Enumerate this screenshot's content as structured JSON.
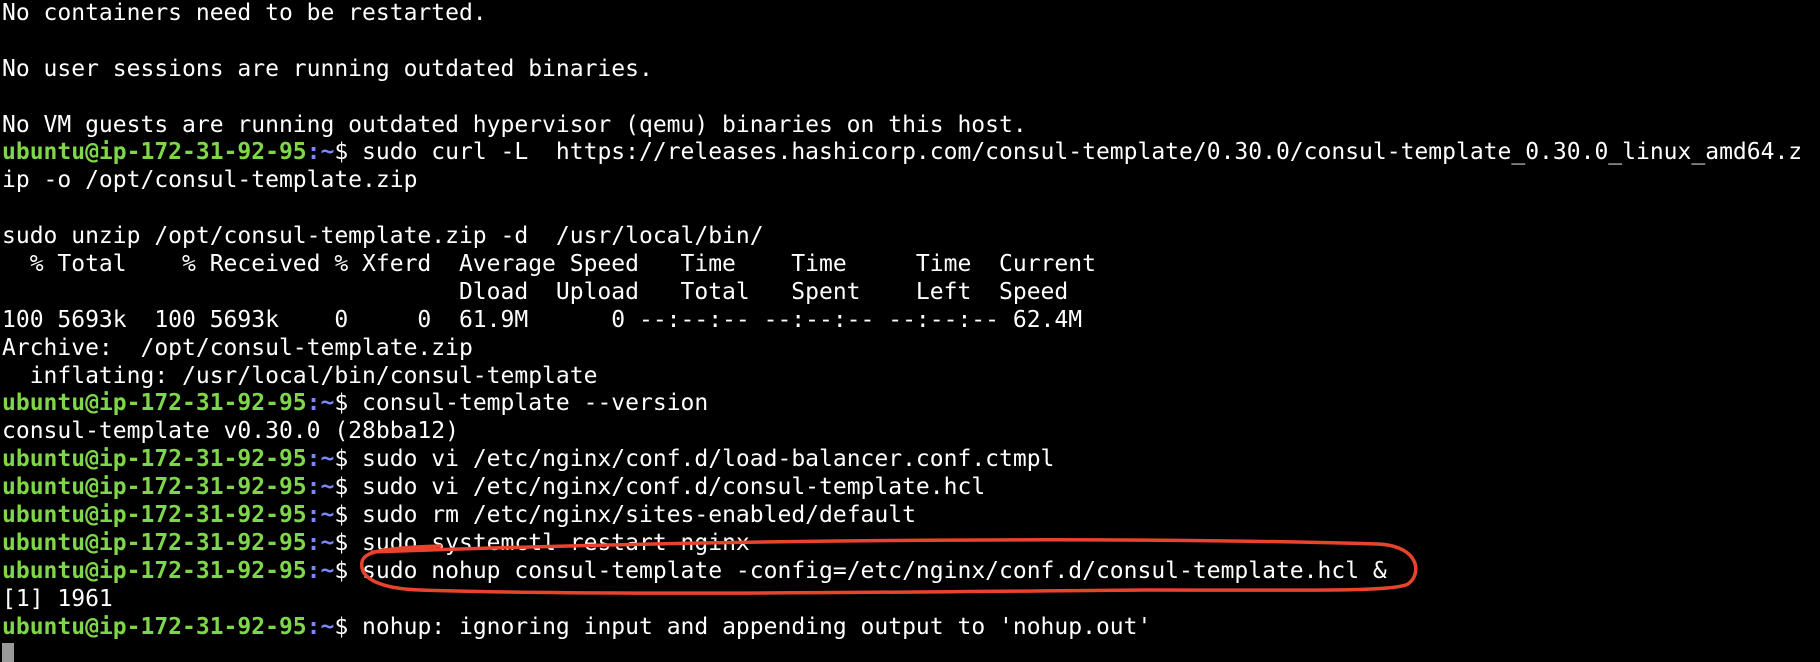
{
  "terminal": {
    "prompt_user": "ubuntu@ip-172-31-92-95",
    "prompt_path": ":~",
    "prompt_symbol": "$",
    "lines": [
      {
        "text": "No containers need to be restarted."
      },
      {
        "text": ""
      },
      {
        "text": "No user sessions are running outdated binaries."
      },
      {
        "text": ""
      },
      {
        "text": "No VM guests are running outdated hypervisor (qemu) binaries on this host."
      },
      {
        "prompt": true,
        "text": " sudo curl -L  https://releases.hashicorp.com/consul-template/0.30.0/consul-template_0.30.0_linux_amd64.z"
      },
      {
        "text": "ip -o /opt/consul-template.zip"
      },
      {
        "text": ""
      },
      {
        "text": "sudo unzip /opt/consul-template.zip -d  /usr/local/bin/"
      },
      {
        "text": "  % Total    % Received % Xferd  Average Speed   Time    Time     Time  Current"
      },
      {
        "text": "                                 Dload  Upload   Total   Spent    Left  Speed"
      },
      {
        "text": "100 5693k  100 5693k    0     0  61.9M      0 --:--:-- --:--:-- --:--:-- 62.4M"
      },
      {
        "text": "Archive:  /opt/consul-template.zip"
      },
      {
        "text": "  inflating: /usr/local/bin/consul-template"
      },
      {
        "prompt": true,
        "text": " consul-template --version"
      },
      {
        "text": "consul-template v0.30.0 (28bba12)"
      },
      {
        "prompt": true,
        "text": " sudo vi /etc/nginx/conf.d/load-balancer.conf.ctmpl"
      },
      {
        "prompt": true,
        "text": " sudo vi /etc/nginx/conf.d/consul-template.hcl"
      },
      {
        "prompt": true,
        "text": " sudo rm /etc/nginx/sites-enabled/default"
      },
      {
        "prompt": true,
        "text": " sudo systemctl restart nginx"
      },
      {
        "prompt": true,
        "text": " sudo nohup consul-template -config=/etc/nginx/conf.d/consul-template.hcl &",
        "highlight": true
      },
      {
        "text": "[1] 1961"
      },
      {
        "prompt": true,
        "text": " nohup: ignoring input and appending output to 'nohup.out'"
      },
      {
        "cursor": true,
        "text": ""
      }
    ]
  },
  "colors": {
    "background": "#000000",
    "foreground": "#ffffff",
    "prompt_user": "#7fd64a",
    "prompt_path": "#7b86ff",
    "cursor": "#9a9a9a",
    "annotation_stroke": "#e8432d"
  }
}
